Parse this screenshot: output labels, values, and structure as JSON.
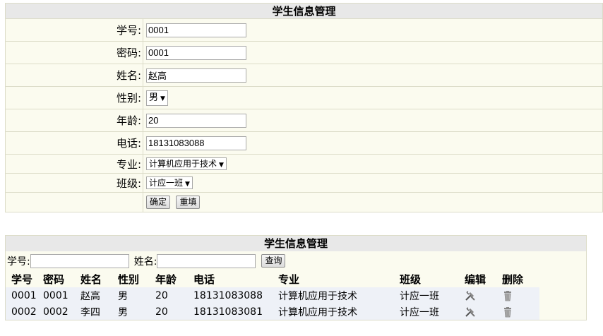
{
  "form": {
    "title": "学生信息管理",
    "fields": {
      "student_id": {
        "label": "学号:",
        "value": "0001"
      },
      "password": {
        "label": "密码:",
        "value": "0001"
      },
      "name": {
        "label": "姓名:",
        "value": "赵高"
      },
      "gender": {
        "label": "性别:",
        "value": "男"
      },
      "age": {
        "label": "年龄:",
        "value": "20"
      },
      "phone": {
        "label": "电话:",
        "value": "18131083088"
      },
      "major": {
        "label": "专业:",
        "value": "计算机应用于技术"
      },
      "class": {
        "label": "班级:",
        "value": "计应一班"
      }
    },
    "confirm_label": "确定",
    "reset_label": "重填"
  },
  "list": {
    "title": "学生信息管理",
    "search": {
      "id_label": "学号:",
      "name_label": "姓名:",
      "button_label": "查询"
    },
    "headers": [
      "学号",
      "密码",
      "姓名",
      "性别",
      "年龄",
      "电话",
      "专业",
      "班级",
      "编辑",
      "删除"
    ],
    "rows": [
      [
        "0001",
        "0001",
        "赵高",
        "男",
        "20",
        "18131083088",
        "计算机应用于技术",
        "计应一班"
      ],
      [
        "0002",
        "0002",
        "李四",
        "男",
        "20",
        "18131083081",
        "计算机应用于技术",
        "计应一班"
      ]
    ]
  }
}
